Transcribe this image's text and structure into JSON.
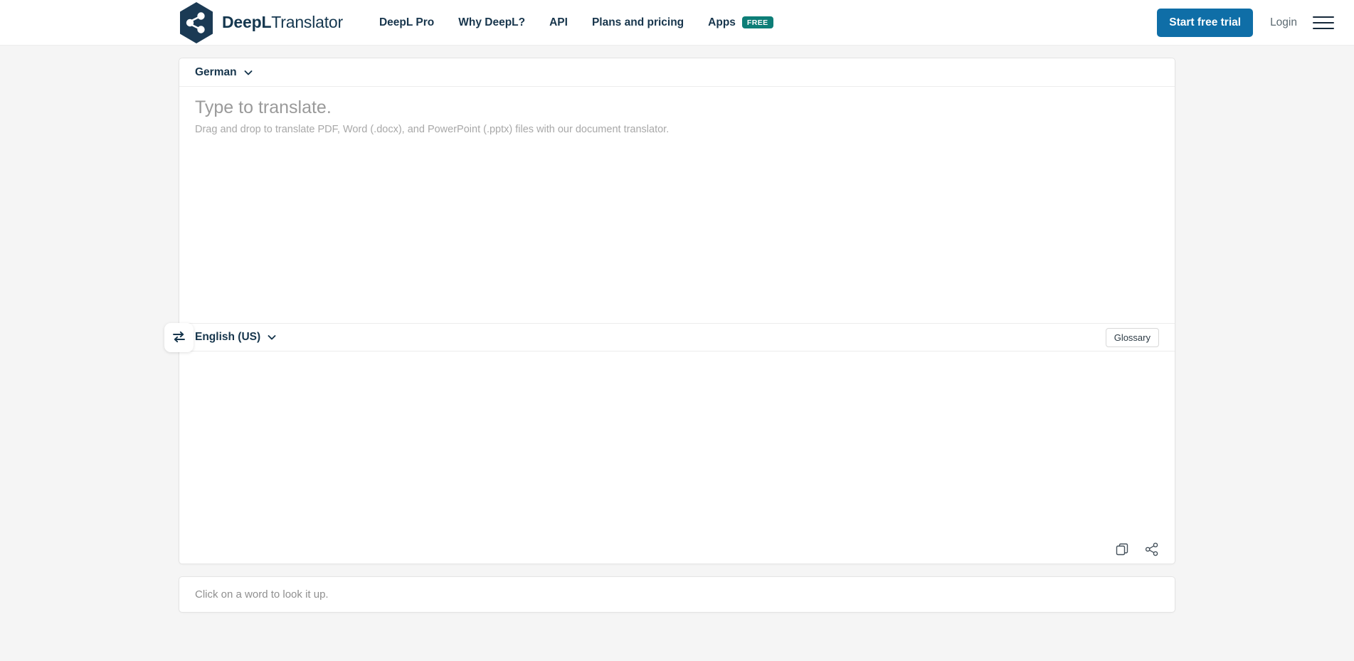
{
  "header": {
    "brand": {
      "bold": "DeepL",
      "light": "Translator",
      "logo_icon": "deepl-share-hexagon-logo"
    },
    "nav": [
      {
        "label": "DeepL Pro"
      },
      {
        "label": "Why DeepL?"
      },
      {
        "label": "API"
      },
      {
        "label": "Plans and pricing"
      },
      {
        "label": "Apps",
        "badge": "FREE"
      }
    ],
    "trial_button": "Start free trial",
    "login_link": "Login",
    "menu_icon": "hamburger-menu-icon"
  },
  "translator": {
    "source": {
      "language": "German",
      "placeholder_main": "Type to translate.",
      "placeholder_sub": "Drag and drop to translate PDF, Word (.docx), and PowerPoint (.pptx) files with our document translator.",
      "text_value": ""
    },
    "target": {
      "language": "English (US)",
      "glossary_label": "Glossary",
      "text_value": "",
      "copy_icon": "copy-icon",
      "share_icon": "share-icon"
    },
    "swap_icon": "swap-languages-icon",
    "chevron_icon": "chevron-down-icon"
  },
  "dictionary": {
    "hint": "Click on a word to look it up."
  },
  "colors": {
    "brand_navy": "#16354c",
    "accent_blue": "#0f6ea7",
    "badge_teal": "#0d7e77",
    "page_bg": "#f5f5f5"
  }
}
